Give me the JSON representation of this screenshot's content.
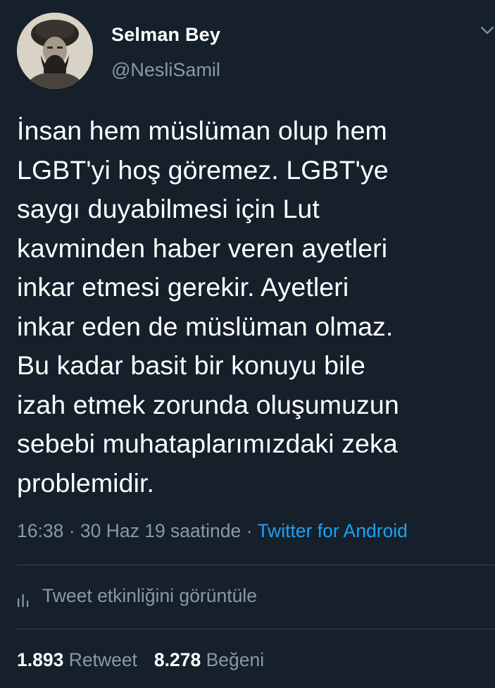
{
  "author": {
    "display_name": "Selman Bey",
    "handle": "@NesliSamil"
  },
  "tweet": {
    "text": "İnsan hem müslüman olup hem\nLGBT'yi hoş göremez. LGBT'ye\nsaygı duyabilmesi için Lut\nkavminden haber veren ayetleri\ninkar etmesi gerekir. Ayetleri\ninkar eden de müslüman olmaz.\nBu kadar basit bir konuyu bile\nizah etmek zorunda oluşumuzun\nsebebi muhataplarımızdaki zeka\nproblemidir."
  },
  "meta": {
    "time": "16:38",
    "separator": " · ",
    "date": "30 Haz 19 saatinde",
    "separator2": " · ",
    "client": "Twitter for Android"
  },
  "activity": {
    "label": "Tweet etkinliğini görüntüle",
    "icon": "bar-chart-icon"
  },
  "stats": {
    "retweet_count": "1.893",
    "retweet_label": "Retweet",
    "like_count": "8.278",
    "like_label": "Beğeni"
  },
  "colors": {
    "background": "#15202b",
    "secondary_text": "#8899a6",
    "link": "#1da1f2",
    "divider": "#38444d"
  }
}
